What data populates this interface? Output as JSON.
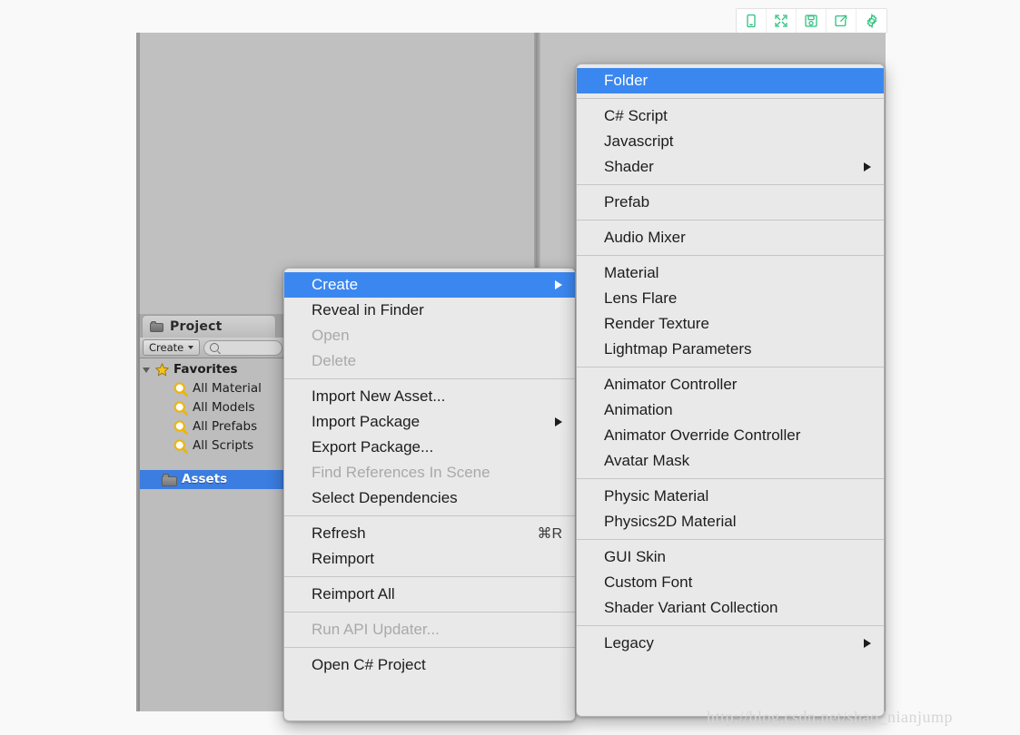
{
  "toolbar": {
    "buttons": [
      {
        "name": "mobile-view-icon",
        "title": "Mobile view"
      },
      {
        "name": "fullscreen-icon",
        "title": "Fullscreen"
      },
      {
        "name": "save-icon",
        "title": "Save"
      },
      {
        "name": "share-icon",
        "title": "Share"
      },
      {
        "name": "settings-gear-icon",
        "title": "Settings"
      }
    ],
    "accent_color": "#2ec27e"
  },
  "project_panel": {
    "tab_label": "Project",
    "create_button_label": "Create",
    "search_value": "",
    "search_placeholder": "",
    "tree": [
      {
        "label": "Favorites",
        "icon": "star-icon",
        "expanded": true,
        "selected": false
      },
      {
        "label": "All Material",
        "icon": "search-icon",
        "selected": false
      },
      {
        "label": "All Models",
        "icon": "search-icon",
        "selected": false
      },
      {
        "label": "All Prefabs",
        "icon": "search-icon",
        "selected": false
      },
      {
        "label": "All Scripts",
        "icon": "search-icon",
        "selected": false
      },
      {
        "label": "Assets",
        "icon": "folder-icon",
        "selected": true
      }
    ]
  },
  "context_menu": {
    "items": [
      {
        "label": "Create",
        "highlight": true,
        "submenu": true
      },
      {
        "label": "Reveal in Finder"
      },
      {
        "label": "Open",
        "disabled": true
      },
      {
        "label": "Delete",
        "disabled": true
      },
      {
        "separator": true
      },
      {
        "label": "Import New Asset..."
      },
      {
        "label": "Import Package",
        "submenu": true
      },
      {
        "label": "Export Package..."
      },
      {
        "label": "Find References In Scene",
        "disabled": true
      },
      {
        "label": "Select Dependencies"
      },
      {
        "separator": true
      },
      {
        "label": "Refresh",
        "shortcut": "⌘R"
      },
      {
        "label": "Reimport"
      },
      {
        "separator": true
      },
      {
        "label": "Reimport All"
      },
      {
        "separator": true
      },
      {
        "label": "Run API Updater...",
        "disabled": true
      },
      {
        "separator": true
      },
      {
        "label": "Open C# Project"
      }
    ]
  },
  "create_submenu": {
    "items": [
      {
        "label": "Folder",
        "highlight": true
      },
      {
        "separator": true
      },
      {
        "label": "C# Script"
      },
      {
        "label": "Javascript"
      },
      {
        "label": "Shader",
        "submenu": true
      },
      {
        "separator": true
      },
      {
        "label": "Prefab"
      },
      {
        "separator": true
      },
      {
        "label": "Audio Mixer"
      },
      {
        "separator": true
      },
      {
        "label": "Material"
      },
      {
        "label": "Lens Flare"
      },
      {
        "label": "Render Texture"
      },
      {
        "label": "Lightmap Parameters"
      },
      {
        "separator": true
      },
      {
        "label": "Animator Controller"
      },
      {
        "label": "Animation"
      },
      {
        "label": "Animator Override Controller"
      },
      {
        "label": "Avatar Mask"
      },
      {
        "separator": true
      },
      {
        "label": "Physic Material"
      },
      {
        "label": "Physics2D Material"
      },
      {
        "separator": true
      },
      {
        "label": "GUI Skin"
      },
      {
        "label": "Custom Font"
      },
      {
        "label": "Shader Variant Collection"
      },
      {
        "separator": true
      },
      {
        "label": "Legacy",
        "submenu": true
      }
    ]
  },
  "watermark": {
    "text": "http://blog.csdn.net/shao_nianjump"
  },
  "colors": {
    "menu_highlight": "#3b87f0",
    "menu_background": "#e9e9e9",
    "tree_selection": "#3b7de0",
    "page_background": "#f9f9f9"
  }
}
